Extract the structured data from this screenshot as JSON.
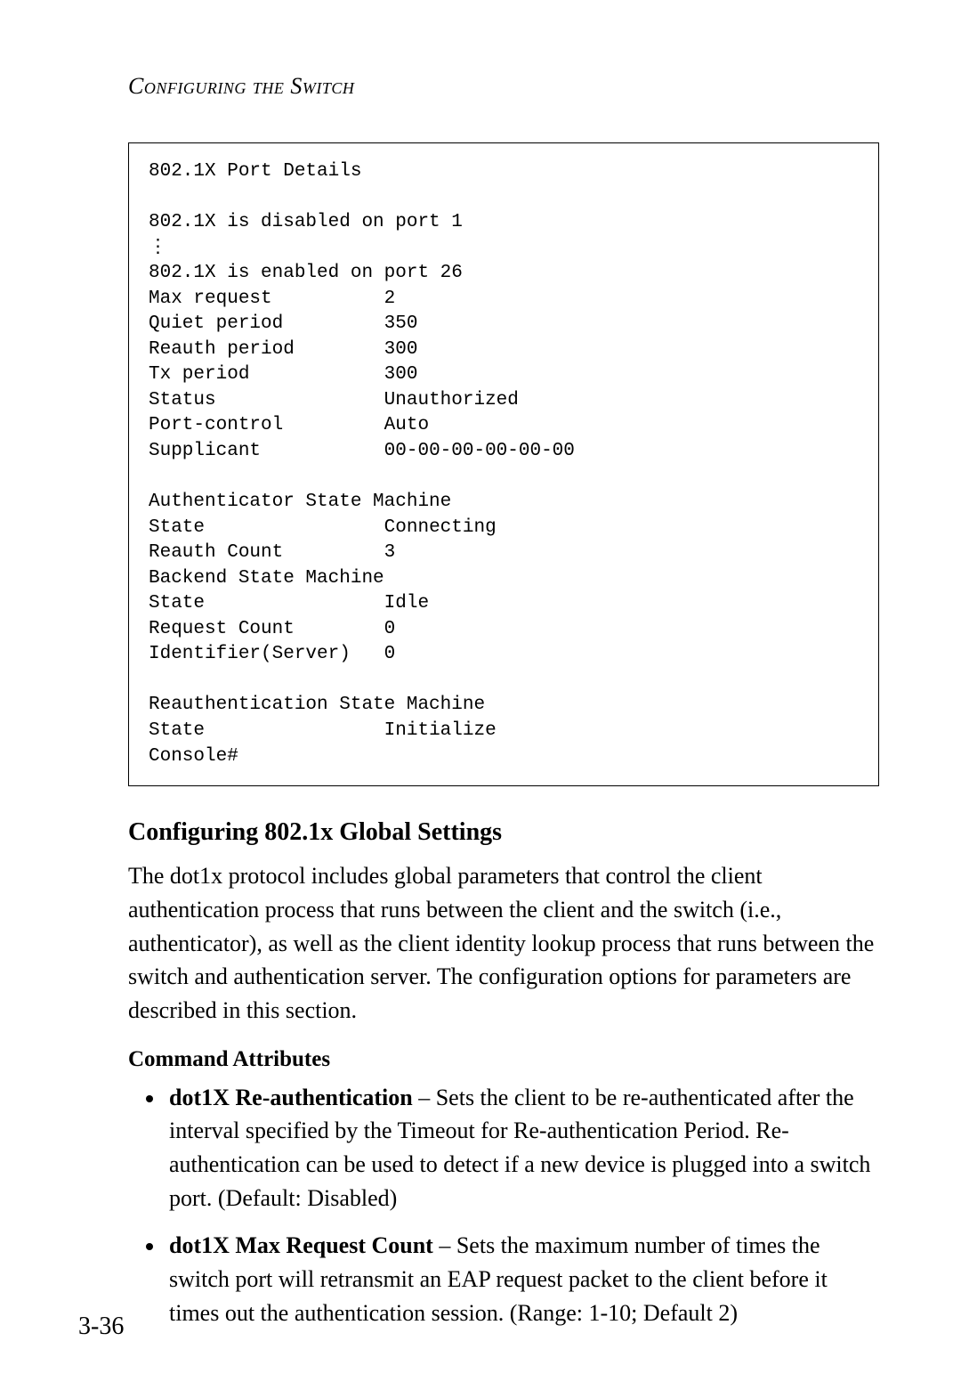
{
  "running_head": "Configuring the Switch",
  "console": {
    "title": "802.1X Port Details",
    "disabled_line": "802.1X is disabled on port 1",
    "enabled_line": "802.1X is enabled on port 26",
    "params": [
      {
        "label": "Max request",
        "value": "2"
      },
      {
        "label": "Quiet period",
        "value": "350"
      },
      {
        "label": "Reauth period",
        "value": "300"
      },
      {
        "label": "Tx period",
        "value": "300"
      },
      {
        "label": "Status",
        "value": "Unauthorized"
      },
      {
        "label": "Port-control",
        "value": "Auto"
      },
      {
        "label": "Supplicant",
        "value": "00-00-00-00-00-00"
      }
    ],
    "auth_header": "Authenticator State Machine",
    "auth_rows": [
      {
        "label": "State",
        "value": "Connecting"
      },
      {
        "label": "Reauth Count",
        "value": "3"
      }
    ],
    "backend_header": "Backend State Machine",
    "backend_rows": [
      {
        "label": "State",
        "value": "Idle"
      },
      {
        "label": "Request Count",
        "value": "0"
      },
      {
        "label": "Identifier(Server)",
        "value": "0"
      }
    ],
    "reauth_header": "Reauthentication State Machine",
    "reauth_rows": [
      {
        "label": "State",
        "value": "Initialize"
      }
    ],
    "prompt": "Console#"
  },
  "section_title": "Configuring 802.1x Global Settings",
  "section_body": "The dot1x protocol includes global parameters that control the client authentication process that runs between the client and the switch (i.e., authenticator), as well as the client identity lookup process that runs between the switch and authentication server. The configuration options for parameters are described in this section.",
  "command_attrs_head": "Command Attributes",
  "bullets": [
    {
      "term": "dot1X Re-authentication",
      "desc": " – Sets the client to be re-authenticated after the interval specified by the Timeout for Re-authentication Period. Re-authentication can be used to detect if a new device is plugged into a switch port. (Default: Disabled)"
    },
    {
      "term": "dot1X Max Request Count",
      "desc": " – Sets the maximum number of times the switch port will retransmit an EAP request packet to the client before it times out the authentication session. (Range: 1-10; Default 2)"
    }
  ],
  "page_number": "3-36"
}
